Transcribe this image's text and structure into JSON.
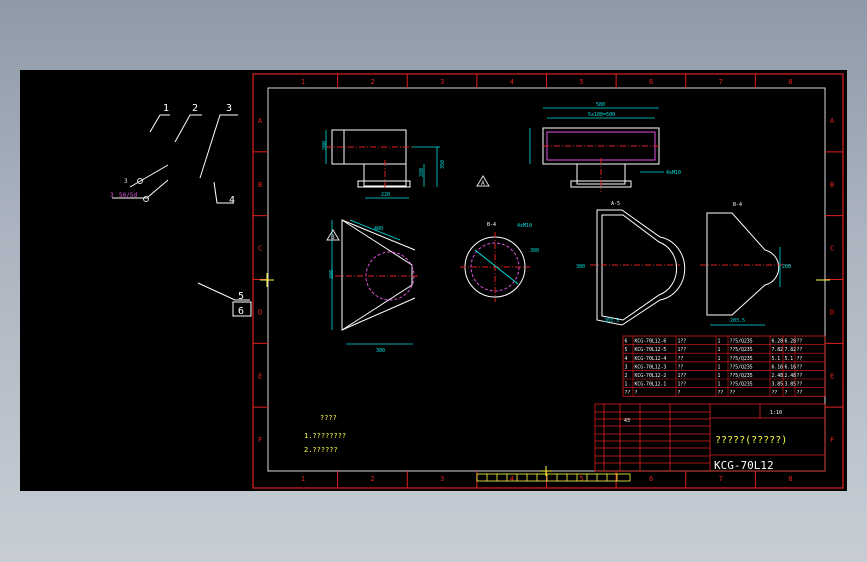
{
  "border": {
    "top_numbers": [
      "1",
      "2",
      "3",
      "4",
      "5",
      "6",
      "7",
      "8"
    ],
    "side_letters": [
      "A",
      "B",
      "C",
      "D",
      "E",
      "F"
    ]
  },
  "leaders": {
    "items": [
      "1",
      "2",
      "3",
      "4",
      "5",
      "6"
    ],
    "symbol_a": "3",
    "symbol_b": "3",
    "symbol_b_text": "50/5d"
  },
  "views": {
    "view_a_label": "A",
    "view_b_label": "B",
    "section_4a": "B-4",
    "section_5": "A-5",
    "section_4b": "B-4",
    "note_small": "4xM10"
  },
  "dims": {
    "top_total": "580",
    "top_inner": "5x100=500",
    "front_width": "200",
    "front_height": "350",
    "side_height": "280",
    "plate_width": "220",
    "tri_width": "300",
    "tri_depth": "380",
    "tri_small": "480",
    "circle_dia": "300",
    "c_w": "203.5",
    "c_h": "380",
    "d_w": "203.5",
    "d_h": "200"
  },
  "notes": {
    "title": "????",
    "line1": "1.????????",
    "line2": "2.??????"
  },
  "bom": {
    "rows": [
      {
        "no": "6",
        "code": "KCG-70L12-6",
        "name": "1??",
        "qty": "1",
        "mat": "??5/Q235",
        "w1": "6.28",
        "w2": "6.28",
        "note": "??"
      },
      {
        "no": "5",
        "code": "KCG-70L12-5",
        "name": "1??",
        "qty": "1",
        "mat": "??5/Q235",
        "w1": "7.82",
        "w2": "7.82",
        "note": "??"
      },
      {
        "no": "4",
        "code": "KCG-70L12-4",
        "name": "??",
        "qty": "1",
        "mat": "??5/Q235",
        "w1": "5.1",
        "w2": "5.1",
        "note": "??"
      },
      {
        "no": "3",
        "code": "KCG-70L12-3",
        "name": "??",
        "qty": "1",
        "mat": "??5/Q235",
        "w1": "6.16",
        "w2": "6.16",
        "note": "??"
      },
      {
        "no": "2",
        "code": "KCG-70L12-2",
        "name": "1??",
        "qty": "1",
        "mat": "??5/Q235",
        "w1": "2.48",
        "w2": "2.48",
        "note": "??"
      },
      {
        "no": "1",
        "code": "KCG-70L12-1",
        "name": "1??",
        "qty": "1",
        "mat": "??5/Q235",
        "w1": "3.85",
        "w2": "3.85",
        "note": "??"
      }
    ],
    "header": [
      "??",
      "?",
      "?",
      "??",
      "??",
      "??",
      "?",
      "??"
    ]
  },
  "title_block": {
    "cell_a": "43",
    "scale": "1:10",
    "title": "?????(?????)",
    "drawing_no": "KCG-70L12"
  }
}
